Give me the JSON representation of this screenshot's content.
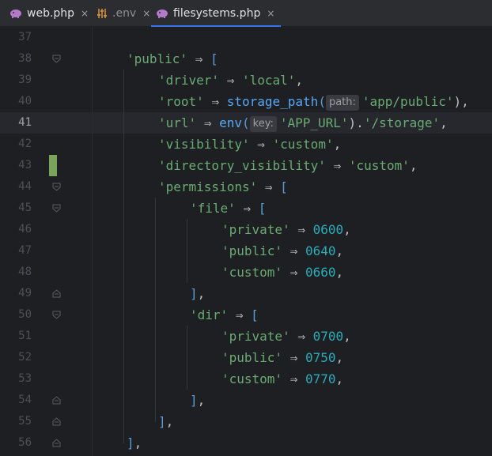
{
  "tabs": [
    {
      "label": "web.php",
      "icon": "php-elephant-icon",
      "active": false,
      "close": "×"
    },
    {
      "label": ".env",
      "icon": "env-settings-icon",
      "active": false,
      "close": "×"
    },
    {
      "label": "filesystems.php",
      "icon": "php-elephant-icon",
      "active": true,
      "close": "×"
    }
  ],
  "gutter": {
    "line_numbers": [
      "37",
      "38",
      "39",
      "40",
      "41",
      "42",
      "43",
      "44",
      "45",
      "46",
      "47",
      "48",
      "49",
      "50",
      "51",
      "52",
      "53",
      "54",
      "55",
      "56"
    ],
    "current_line": "41"
  },
  "code": {
    "l38": {
      "key": "'public'",
      "arrow": "⇒",
      "open": "["
    },
    "l39": {
      "key": "'driver'",
      "arrow": "⇒",
      "value": "'local'",
      "end": ","
    },
    "l40": {
      "key": "'root'",
      "arrow": "⇒",
      "fn": "storage_path",
      "paren_open": "(",
      "hint": "path:",
      "value": "'app/public'",
      "end": "),"
    },
    "l41": {
      "key": "'url'",
      "arrow": "⇒",
      "fn": "env",
      "paren_open": "(",
      "hint": "key:",
      "value": "'APP_URL'",
      "mid": ").",
      "value2": "'/storage'",
      "end": ","
    },
    "l42": {
      "key": "'visibility'",
      "arrow": "⇒",
      "value": "'custom'",
      "end": ","
    },
    "l43": {
      "key": "'directory_visibility'",
      "arrow": "⇒",
      "value": "'custom'",
      "end": ","
    },
    "l44": {
      "key": "'permissions'",
      "arrow": "⇒",
      "open": "["
    },
    "l45": {
      "key": "'file'",
      "arrow": "⇒",
      "open": "["
    },
    "l46": {
      "key": "'private'",
      "arrow": "⇒",
      "value": "0600",
      "end": ","
    },
    "l47": {
      "key": "'public'",
      "arrow": "⇒",
      "value": "0640",
      "end": ","
    },
    "l48": {
      "key": "'custom'",
      "arrow": "⇒",
      "value": "0660",
      "end": ","
    },
    "l49": {
      "close": "]",
      "end": ","
    },
    "l50": {
      "key": "'dir'",
      "arrow": "⇒",
      "open": "["
    },
    "l51": {
      "key": "'private'",
      "arrow": "⇒",
      "value": "0700",
      "end": ","
    },
    "l52": {
      "key": "'public'",
      "arrow": "⇒",
      "value": "0750",
      "end": ","
    },
    "l53": {
      "key": "'custom'",
      "arrow": "⇒",
      "value": "0770",
      "end": ","
    },
    "l54": {
      "close": "]",
      "end": ","
    },
    "l55": {
      "close": "]",
      "end": ","
    },
    "l56": {
      "close": "]",
      "end": ","
    }
  },
  "colors": {
    "editor_bg": "#1e1f22",
    "string": "#6aab73",
    "number": "#2aacb8",
    "function": "#56a8f5",
    "bracket": "#5f9ad2",
    "tab_accent": "#3574f0",
    "vcs_modified": "#7aa45a"
  }
}
